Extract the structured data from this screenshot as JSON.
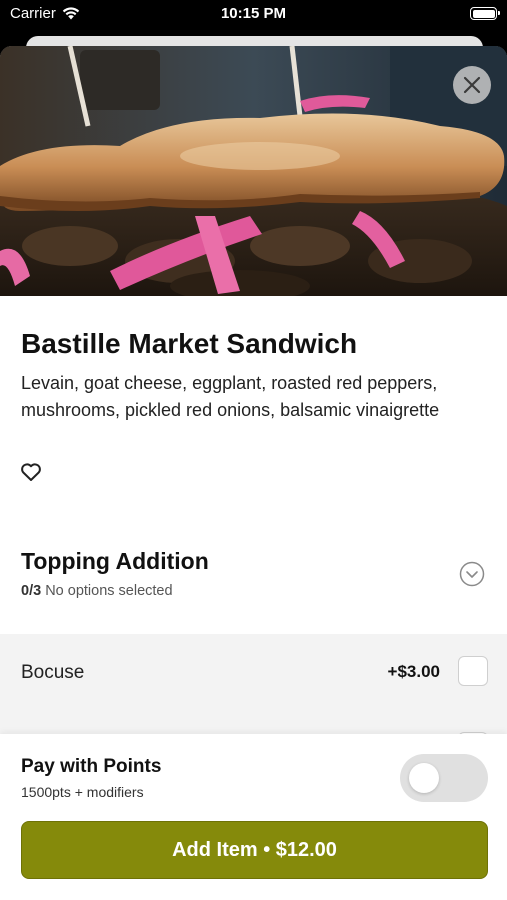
{
  "status_bar": {
    "carrier": "Carrier",
    "time": "10:15 PM",
    "icons": [
      "wifi-icon",
      "battery-icon"
    ]
  },
  "item": {
    "title": "Bastille Market Sandwich",
    "description": "Levain, goat cheese, eggplant, roasted red peppers, mushrooms, pickled red onions, balsamic vinaigrette",
    "image": "sandwich-photo",
    "favorite_icon": "heart-outline-icon"
  },
  "section": {
    "title": "Topping Addition",
    "count": "0/3",
    "status": "No options selected",
    "expand_icon": "chevron-down-circle-icon"
  },
  "options": [
    {
      "name": "Bocuse",
      "price": "+$3.00",
      "checked": false
    }
  ],
  "footer": {
    "pay_label": "Pay with Points",
    "pay_sub": "1500pts + modifiers",
    "toggle_on": false,
    "add_button": "Add Item • $12.00"
  },
  "colors": {
    "accent": "#858a0b",
    "options_bg": "#f3f3f3",
    "toggle_off": "#e0e0e0"
  }
}
